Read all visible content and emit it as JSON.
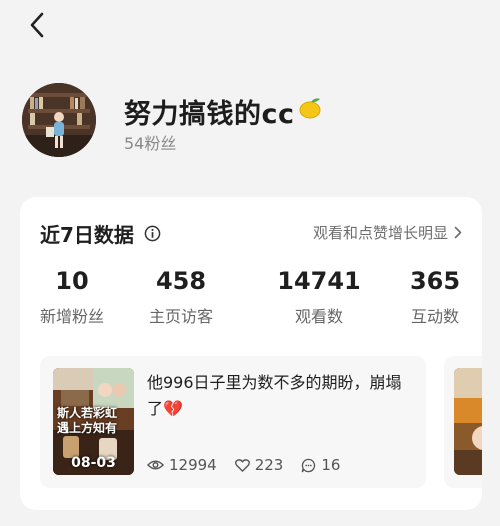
{
  "profile": {
    "name": "努力搞钱的cc",
    "fans_label": "54粉丝"
  },
  "card": {
    "title": "近7日数据",
    "link_text": "观看和点赞增长明显",
    "stats": [
      {
        "value": "10",
        "label": "新增粉丝"
      },
      {
        "value": "458",
        "label": "主页访客"
      },
      {
        "value": "14741",
        "label": "观看数"
      },
      {
        "value": "365",
        "label": "互动数"
      }
    ]
  },
  "post": {
    "title": "他996日子里为数不多的期盼，崩塌了💔",
    "thumb_date": "08-03",
    "thumb_caption_line1": "斯人若彩虹",
    "thumb_caption_line2": "遇上方知有",
    "views": "12994",
    "likes": "223",
    "comments": "16"
  },
  "icons": {
    "back": "chevron-left-icon",
    "info": "info-circle-icon",
    "chevron": "chevron-right-icon",
    "views": "eye-icon",
    "likes": "heart-icon",
    "comments": "comment-icon",
    "emoji": "lemon-icon"
  }
}
